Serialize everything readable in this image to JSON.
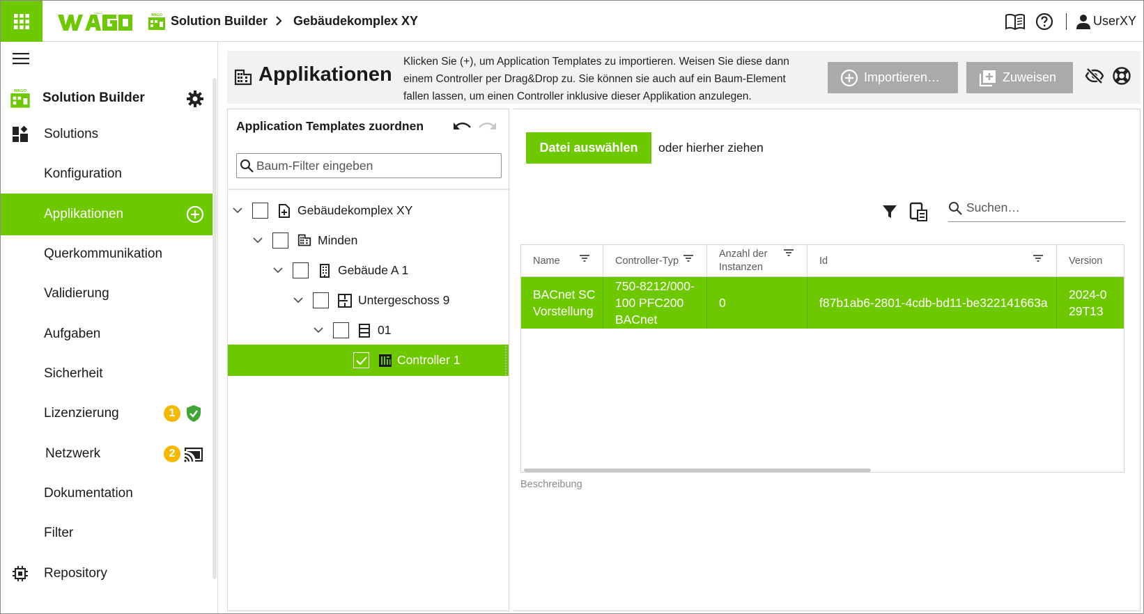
{
  "colors": {
    "brand_green": "#6ec800",
    "badge_yellow": "#f5b800",
    "button_gray": "#a9aaab",
    "header_band": "#f2f2f2"
  },
  "topbar": {
    "logo_text": "WAGO",
    "app_name": "Solution Builder",
    "breadcrumb_current": "Gebäudekomplex XY",
    "user": "UserXY",
    "icons": [
      "apps-grid-icon",
      "manual-book-icon",
      "help-icon",
      "user-icon"
    ]
  },
  "sidebar": {
    "brand_label": "Solution Builder",
    "items": [
      {
        "label": "Solutions",
        "icon": "dashboard-icon"
      },
      {
        "label": "Konfiguration"
      },
      {
        "label": "Applikationen",
        "active": true,
        "action_icon": "add-circle-icon"
      },
      {
        "label": "Querkommunikation"
      },
      {
        "label": "Validierung"
      },
      {
        "label": "Aufgaben"
      },
      {
        "label": "Sicherheit"
      },
      {
        "label": "Lizenzierung",
        "badge": "1",
        "status_icon": "shield-check-icon"
      },
      {
        "label": "Netzwerk",
        "badge": "2",
        "status_icon": "cast-connected-icon"
      },
      {
        "label": "Dokumentation"
      },
      {
        "label": "Filter"
      },
      {
        "label": "Repository",
        "icon": "chip-icon"
      }
    ]
  },
  "header": {
    "title": "Applikationen",
    "description": "Klicken Sie (+), um Application Templates zu importieren. Weisen Sie diese dann einem Controller per Drag&Drop zu. Sie können sie auch auf ein Baum-Element fallen lassen, um einen Controller inklusive dieser Applikation anzulegen.",
    "import_label": "Importieren…",
    "assign_label": "Zuweisen"
  },
  "tree": {
    "title": "Application Templates zuordnen",
    "filter_placeholder": "Baum-Filter eingeben",
    "nodes": [
      {
        "label": "Gebäudekomplex XY",
        "level": 0,
        "icon": "document-plus-icon",
        "expanded": true,
        "checked": false
      },
      {
        "label": "Minden",
        "level": 1,
        "icon": "city-icon",
        "expanded": true,
        "checked": false
      },
      {
        "label": "Gebäude A 1",
        "level": 2,
        "icon": "building-icon",
        "expanded": true,
        "checked": false
      },
      {
        "label": "Untergeschoss 9",
        "level": 3,
        "icon": "floor-plan-icon",
        "expanded": true,
        "checked": false
      },
      {
        "label": "01",
        "level": 4,
        "icon": "cabinet-icon",
        "expanded": true,
        "checked": false
      },
      {
        "label": "Controller 1",
        "level": 5,
        "icon": "controller-icon",
        "checked": true,
        "selected": true
      }
    ]
  },
  "upload": {
    "button_label": "Datei auswählen",
    "hint": "oder hierher ziehen",
    "search_placeholder": "Suchen…"
  },
  "table": {
    "columns": [
      "Name",
      "Controller-Typ",
      "Anzahl der Instanzen",
      "Id",
      "Version"
    ],
    "rows": [
      {
        "name": "BACnet SC Vorstellung",
        "controller_type": "750-8212/000-100 PFC200 BACnet",
        "instances": "0",
        "id": "f87b1ab6-2801-4cdb-bd11-be322141663a",
        "version": "2024-0 29T13"
      }
    ]
  },
  "description_label": "Beschreibung"
}
